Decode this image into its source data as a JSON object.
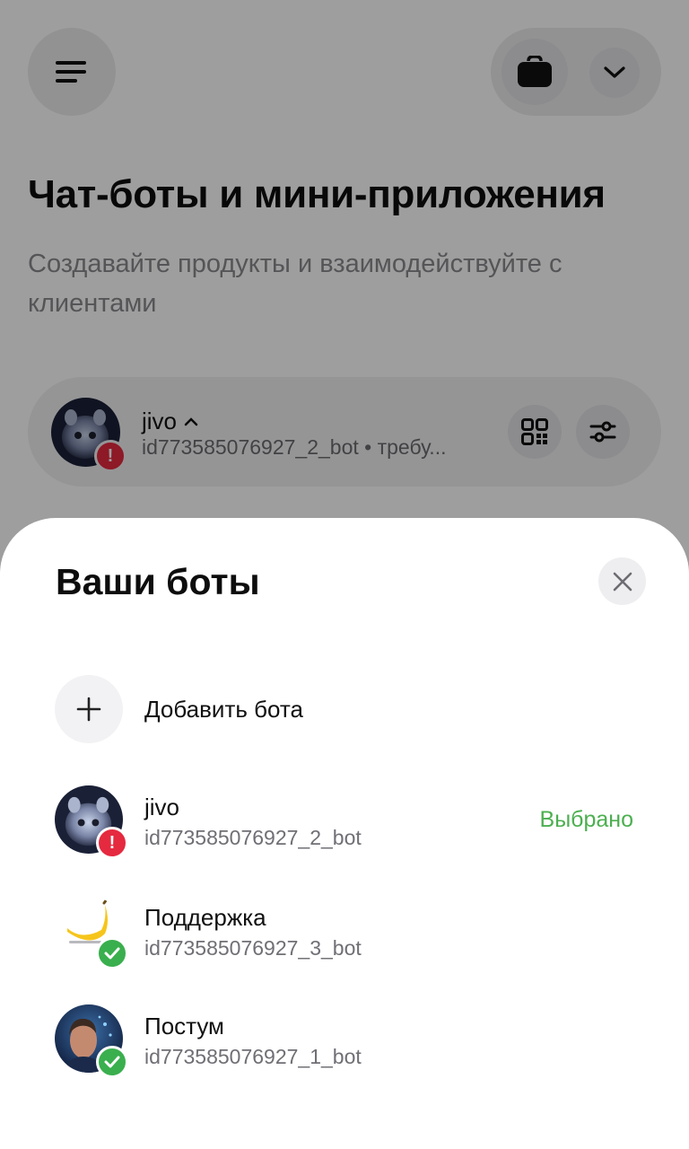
{
  "header": {
    "menu_icon": "hamburger-icon",
    "bag_icon": "briefcase-icon",
    "dropdown_icon": "chevron-down-icon"
  },
  "page": {
    "title": "Чат-боты и мини-приложения",
    "subtitle": "Создавайте продукты и взаимодействуйте с клиентами"
  },
  "current_bot": {
    "name": "jivo",
    "id_status": "id773585076927_2_bot • требу...",
    "badge": "!",
    "qr_icon": "qr-code-icon",
    "settings_icon": "sliders-icon"
  },
  "sheet": {
    "title": "Ваши боты",
    "close_icon": "close-icon",
    "add_label": "Добавить бота",
    "bots": [
      {
        "name": "jivo",
        "id": "id773585076927_2_bot",
        "status": "Выбрано",
        "badge": "!",
        "badge_type": "error"
      },
      {
        "name": "Поддержка",
        "id": "id773585076927_3_bot",
        "status": "",
        "badge": "✓",
        "badge_type": "ok"
      },
      {
        "name": "Постум",
        "id": "id773585076927_1_bot",
        "status": "",
        "badge": "✓",
        "badge_type": "ok"
      }
    ]
  },
  "colors": {
    "accent_green": "#4caf50",
    "error_red": "#e5293f",
    "ok_green": "#3aaf4e"
  }
}
